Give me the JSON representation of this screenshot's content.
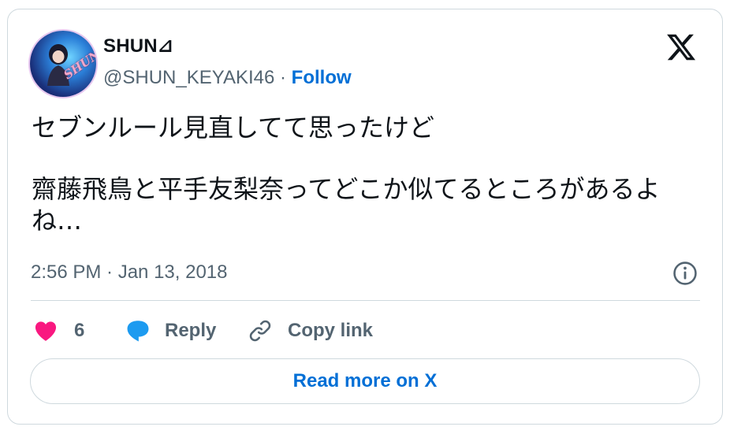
{
  "author": {
    "display_name": "SHUN⊿",
    "handle": "@SHUN_KEYAKI46",
    "separator": " · ",
    "follow_label": "Follow",
    "avatar_signature": "SHUN"
  },
  "tweet": {
    "line1": "セブンルール見直してて思ったけど",
    "line2": "齋藤飛鳥と平手友梨奈ってどこか似てるところがあるよね…",
    "timestamp": "2:56 PM · Jan 13, 2018"
  },
  "actions": {
    "like_count": "6",
    "reply_label": "Reply",
    "copy_link_label": "Copy link"
  },
  "read_more_label": "Read more on X",
  "icons": {
    "like": "heart-icon",
    "reply": "speech-bubble-icon",
    "copy": "link-icon",
    "info": "info-icon",
    "brand": "x-logo-icon"
  },
  "colors": {
    "accent": "#006fd6",
    "like": "#f91880",
    "reply": "#1d9bf0",
    "text": "#0f1419",
    "muted": "#536471",
    "border": "#cfd9de"
  }
}
